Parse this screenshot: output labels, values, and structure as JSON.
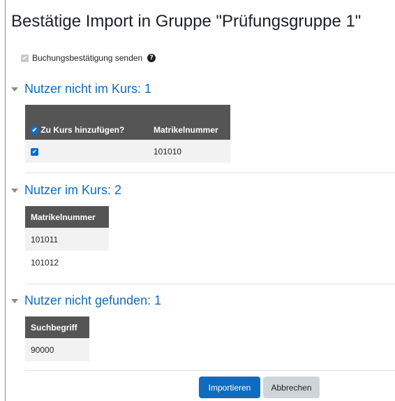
{
  "page": {
    "title": "Bestätige Import in Gruppe \"Prüfungsgruppe 1\""
  },
  "notify": {
    "label": "Buchungsbestätigung senden",
    "checked": true,
    "help_icon": "question-circle-icon"
  },
  "sections": [
    {
      "title": "Nutzer nicht im Kurs: 1",
      "columns": [
        "Zu Kurs hinzufügen?",
        "Matrikelnummer"
      ],
      "rows": [
        {
          "checked": true,
          "matrikelnummer": "101010"
        }
      ]
    },
    {
      "title": "Nutzer im Kurs: 2",
      "columns": [
        "Matrikelnummer"
      ],
      "rows": [
        {
          "matrikelnummer": "101011"
        },
        {
          "matrikelnummer": "101012"
        }
      ]
    },
    {
      "title": "Nutzer nicht gefunden: 1",
      "columns": [
        "Suchbegriff"
      ],
      "rows": [
        {
          "suchbegriff": "90000"
        }
      ]
    }
  ],
  "buttons": {
    "import_label": "Importieren",
    "cancel_label": "Abbrechen"
  },
  "colors": {
    "link": "#0f6cbf",
    "header_bg": "#555555",
    "checkbox": "#0a6ed1",
    "primary": "#0f6cbf"
  }
}
